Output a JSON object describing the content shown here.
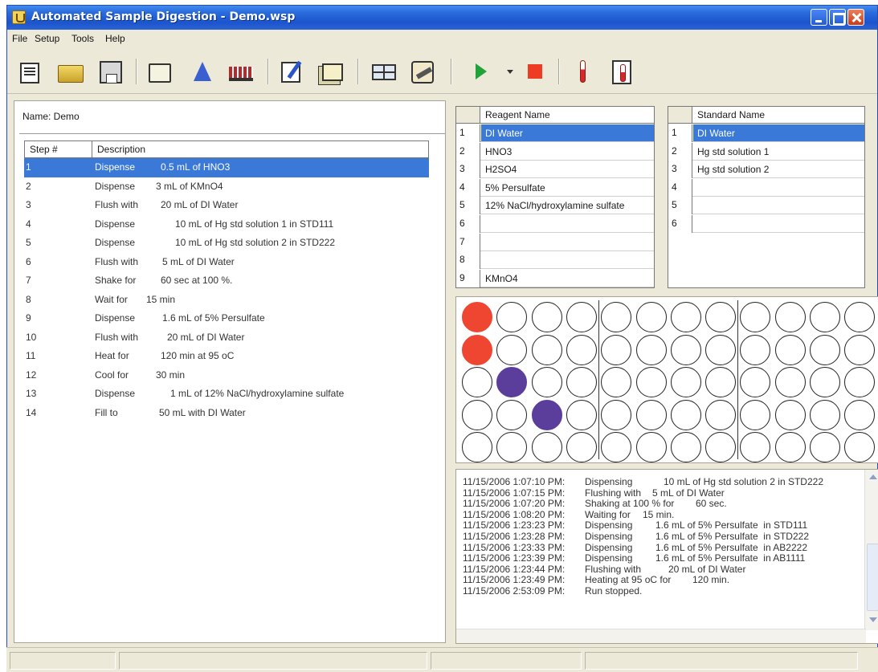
{
  "window": {
    "title": "Automated Sample Digestion - Demo.wsp"
  },
  "menu": {
    "items": [
      "File",
      "Setup",
      "Tools",
      "Help"
    ]
  },
  "toolbar": {
    "icons": [
      "new-method-icon",
      "open-folder-icon",
      "save-disk-icon",
      "print-icon",
      "reagent-flask-icon",
      "sample-rack-icon",
      "edit-notes-icon",
      "cards-icon",
      "grid-layout-icon",
      "tools-icon",
      "run-play-icon",
      "run-dropdown-icon",
      "stop-icon",
      "thermometer-icon",
      "temperature-log-icon"
    ],
    "colors": {
      "play": "#1fa33a",
      "stop": "#ee3b24"
    }
  },
  "method": {
    "name_label": "Name: Demo",
    "headers": {
      "step": "Step #",
      "description": "Description"
    },
    "selected_index": 0,
    "steps": [
      {
        "num": "1",
        "verb": "Dispense",
        "detail": "0.5 mL of HNO3"
      },
      {
        "num": "2",
        "verb": "Dispense",
        "detail": "3 mL of KMnO4"
      },
      {
        "num": "3",
        "verb": "Flush with",
        "detail": "20 mL of DI Water"
      },
      {
        "num": "4",
        "verb": "Dispense",
        "detail": "10 mL of Hg std solution 1 in STD111"
      },
      {
        "num": "5",
        "verb": "Dispense",
        "detail": "10 mL of Hg std solution 2 in STD222"
      },
      {
        "num": "6",
        "verb": "Flush with",
        "detail": "5 mL of DI Water"
      },
      {
        "num": "7",
        "verb": "Shake for",
        "detail": "60 sec at 100 %."
      },
      {
        "num": "8",
        "verb": "Wait for",
        "detail": "15 min"
      },
      {
        "num": "9",
        "verb": "Dispense",
        "detail": "1.6 mL of 5% Persulfate"
      },
      {
        "num": "10",
        "verb": "Flush with",
        "detail": "20 mL of DI Water"
      },
      {
        "num": "11",
        "verb": "Heat for",
        "detail": "120 min at 95 oC"
      },
      {
        "num": "12",
        "verb": "Cool for",
        "detail": "30 min"
      },
      {
        "num": "13",
        "verb": "Dispense",
        "detail": "1 mL of 12% NaCl/hydroxylamine sulfate"
      },
      {
        "num": "14",
        "verb": "Fill to",
        "detail": "50 mL with DI Water"
      }
    ]
  },
  "reagents": {
    "header": "Reagent Name",
    "selected_index": 0,
    "rows": [
      {
        "num": "1",
        "name": "DI Water"
      },
      {
        "num": "2",
        "name": "HNO3"
      },
      {
        "num": "3",
        "name": "H2SO4"
      },
      {
        "num": "4",
        "name": "5% Persulfate"
      },
      {
        "num": "5",
        "name": "12% NaCl/hydroxylamine sulfate"
      },
      {
        "num": "6",
        "name": ""
      },
      {
        "num": "7",
        "name": ""
      },
      {
        "num": "8",
        "name": ""
      },
      {
        "num": "9",
        "name": "KMnO4"
      }
    ]
  },
  "standards": {
    "header": "Standard Name",
    "selected_index": 0,
    "rows": [
      {
        "num": "1",
        "name": "DI Water"
      },
      {
        "num": "2",
        "name": "Hg std solution 1"
      },
      {
        "num": "3",
        "name": "Hg std solution 2"
      },
      {
        "num": "4",
        "name": ""
      },
      {
        "num": "5",
        "name": ""
      },
      {
        "num": "6",
        "name": ""
      }
    ]
  },
  "plate": {
    "rows": 5,
    "cols": 12,
    "group_size": 4,
    "colors": {
      "empty": "#ffffff",
      "red": "#ee4630",
      "purple": "#5b3d9c"
    },
    "filled": [
      {
        "row": 0,
        "col": 0,
        "color": "red"
      },
      {
        "row": 1,
        "col": 0,
        "color": "red"
      },
      {
        "row": 2,
        "col": 1,
        "color": "purple"
      },
      {
        "row": 3,
        "col": 2,
        "color": "purple"
      }
    ]
  },
  "log": {
    "lines": [
      {
        "ts": "11/15/2006 1:07:10 PM:",
        "action": "Dispensing",
        "detail": "10 mL of Hg std solution 2 in STD222"
      },
      {
        "ts": "11/15/2006 1:07:15 PM:",
        "action": "Flushing with",
        "detail": "5 mL of DI Water"
      },
      {
        "ts": "11/15/2006 1:07:20 PM:",
        "action": "Shaking at 100 % for",
        "detail": "60 sec."
      },
      {
        "ts": "11/15/2006 1:08:20 PM:",
        "action": "Waiting for",
        "detail": "15 min."
      },
      {
        "ts": "11/15/2006 1:23:23 PM:",
        "action": "Dispensing",
        "detail": "1.6 mL of 5% Persulfate  in STD111"
      },
      {
        "ts": "11/15/2006 1:23:28 PM:",
        "action": "Dispensing",
        "detail": "1.6 mL of 5% Persulfate  in STD222"
      },
      {
        "ts": "11/15/2006 1:23:33 PM:",
        "action": "Dispensing",
        "detail": "1.6 mL of 5% Persulfate  in AB2222"
      },
      {
        "ts": "11/15/2006 1:23:39 PM:",
        "action": "Dispensing",
        "detail": "1.6 mL of 5% Persulfate  in AB1111"
      },
      {
        "ts": "11/15/2006 1:23:44 PM:",
        "action": "Flushing with",
        "detail": "20 mL of DI Water"
      },
      {
        "ts": "11/15/2006 1:23:49 PM:",
        "action": "Heating at 95 oC for",
        "detail": "120 min."
      },
      {
        "ts": "11/15/2006 2:53:09 PM:",
        "action": "Run stopped.",
        "detail": ""
      }
    ]
  }
}
